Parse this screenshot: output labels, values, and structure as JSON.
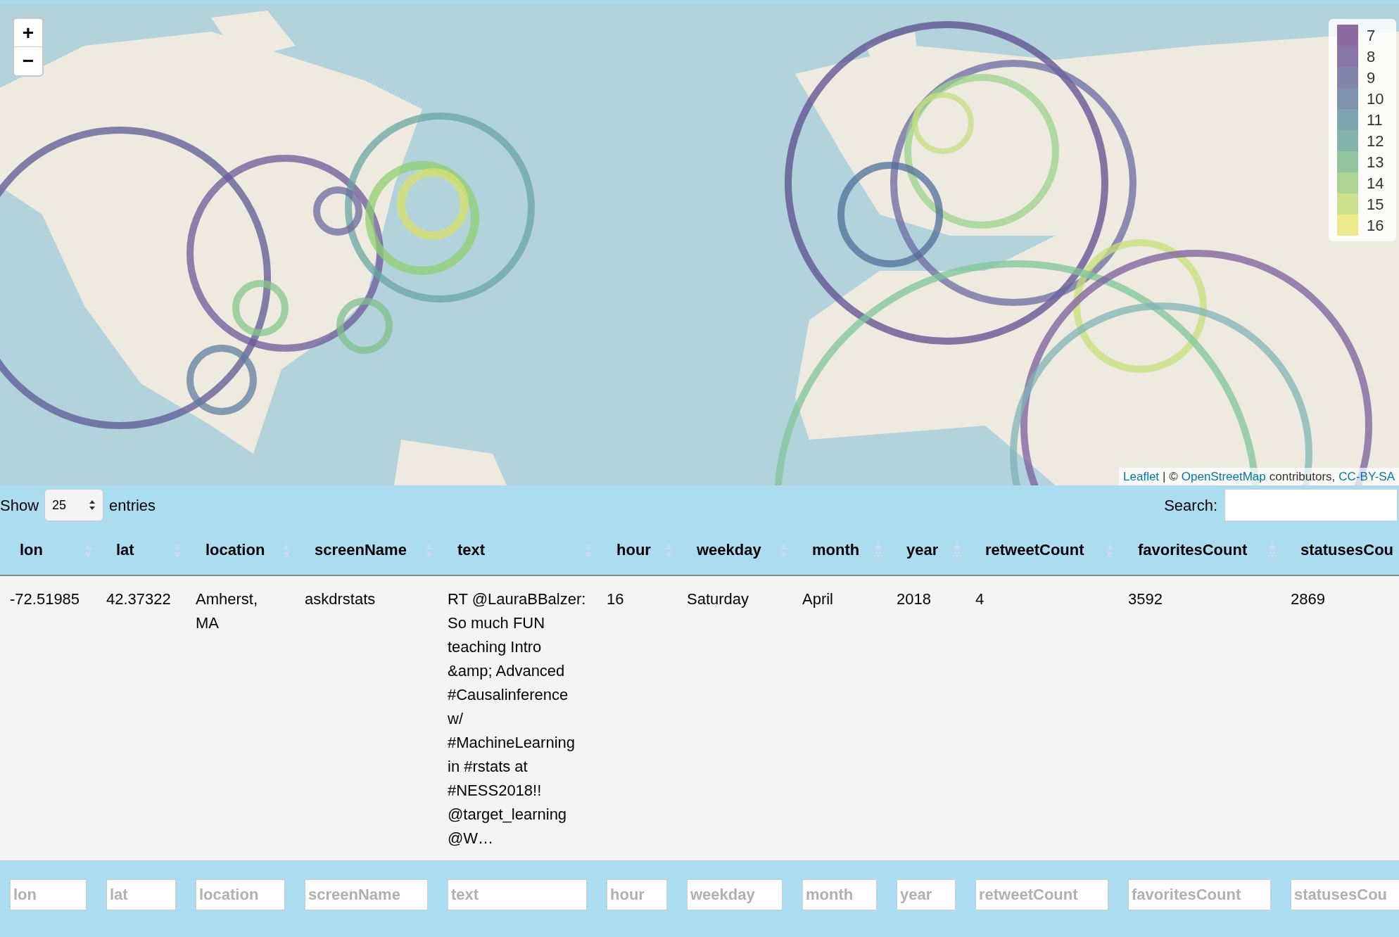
{
  "map": {
    "zoom_in": "+",
    "zoom_out": "−",
    "legend": [
      {
        "label": "7",
        "color": "#8e6aa3"
      },
      {
        "label": "8",
        "color": "#8876a8"
      },
      {
        "label": "9",
        "color": "#8384ab"
      },
      {
        "label": "10",
        "color": "#7f93ae"
      },
      {
        "label": "11",
        "color": "#7fa3b0"
      },
      {
        "label": "12",
        "color": "#84b3ac"
      },
      {
        "label": "13",
        "color": "#93c4a0"
      },
      {
        "label": "14",
        "color": "#aed394"
      },
      {
        "label": "15",
        "color": "#cde08e"
      },
      {
        "label": "16",
        "color": "#ede88c"
      }
    ],
    "attribution": {
      "leaflet": "Leaflet",
      "separator": "| ©",
      "osm": "OpenStreetMap",
      "contributors": "contributors,",
      "license": "CC-BY-SA"
    }
  },
  "controls": {
    "show_label": "Show",
    "page_size": "25",
    "entries_label": "entries",
    "search_label": "Search:"
  },
  "table": {
    "columns": [
      {
        "label": "lon"
      },
      {
        "label": "lat"
      },
      {
        "label": "location"
      },
      {
        "label": "screenName"
      },
      {
        "label": "text"
      },
      {
        "label": "hour"
      },
      {
        "label": "weekday"
      },
      {
        "label": "month"
      },
      {
        "label": "year"
      },
      {
        "label": "retweetCount"
      },
      {
        "label": "favoritesCount"
      },
      {
        "label": "statusesCou"
      }
    ],
    "rows": [
      {
        "cells": [
          "-72.51985",
          "42.37322",
          "Amherst, MA",
          "askdrstats",
          "RT @LauraBBalzer: So much FUN teaching Intro &amp; Advanced #Causalinference w/ #MachineLearning in #rstats at #NESS2018!! @target_learning @W…",
          "16",
          "Saturday",
          "April",
          "2018",
          "4",
          "3592",
          "2869"
        ]
      }
    ],
    "filters": [
      {
        "placeholder": "lon"
      },
      {
        "placeholder": "lat"
      },
      {
        "placeholder": "location"
      },
      {
        "placeholder": "screenName"
      },
      {
        "placeholder": "text"
      },
      {
        "placeholder": "hour"
      },
      {
        "placeholder": "weekday"
      },
      {
        "placeholder": "month"
      },
      {
        "placeholder": "year"
      },
      {
        "placeholder": "retweetCount"
      },
      {
        "placeholder": "favoritesCount"
      },
      {
        "placeholder": "statusesCou"
      }
    ]
  }
}
